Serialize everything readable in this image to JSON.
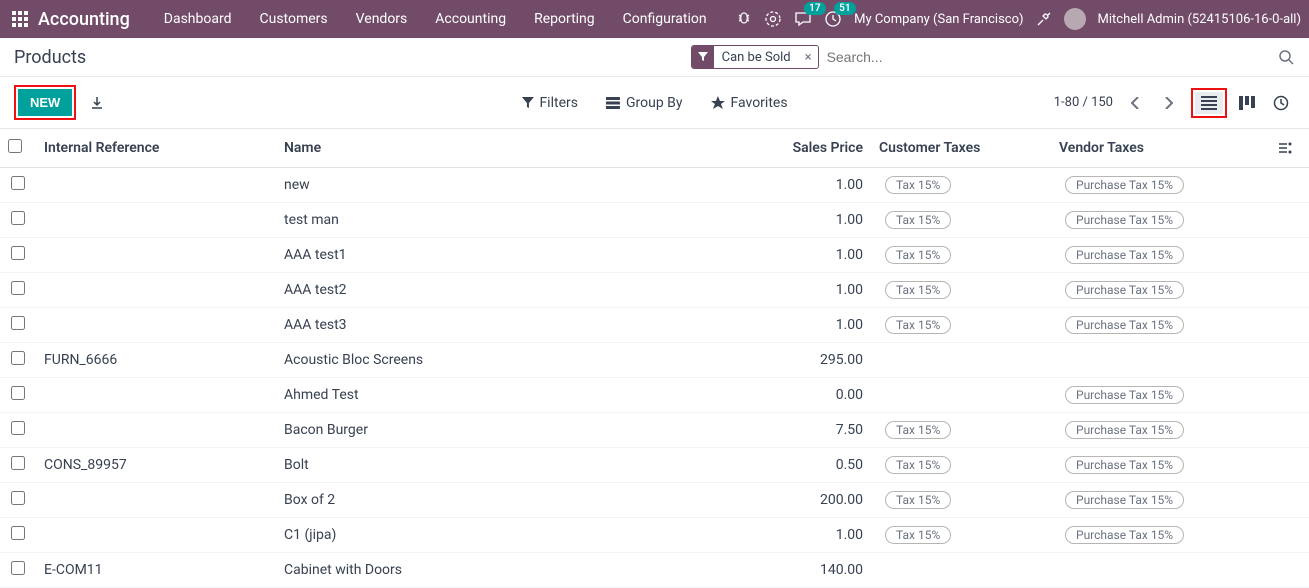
{
  "topnav": {
    "brand": "Accounting",
    "menu": [
      "Dashboard",
      "Customers",
      "Vendors",
      "Accounting",
      "Reporting",
      "Configuration"
    ],
    "chat_badge": "17",
    "activity_badge": "51",
    "company": "My Company (San Francisco)",
    "user": "Mitchell Admin (52415106-16-0-all)"
  },
  "page": {
    "title": "Products",
    "new_label": "NEW"
  },
  "search": {
    "facet_label": "Can be Sold",
    "placeholder": "Search..."
  },
  "controls": {
    "filters": "Filters",
    "group_by": "Group By",
    "favorites": "Favorites",
    "pager": "1-80 / 150"
  },
  "table": {
    "headers": {
      "ref": "Internal Reference",
      "name": "Name",
      "price": "Sales Price",
      "ctax": "Customer Taxes",
      "vtax": "Vendor Taxes"
    },
    "rows": [
      {
        "ref": "",
        "name": "new",
        "price": "1.00",
        "ctax": "Tax 15%",
        "vtax": "Purchase Tax 15%"
      },
      {
        "ref": "",
        "name": "test man",
        "price": "1.00",
        "ctax": "Tax 15%",
        "vtax": "Purchase Tax 15%"
      },
      {
        "ref": "",
        "name": "AAA test1",
        "price": "1.00",
        "ctax": "Tax 15%",
        "vtax": "Purchase Tax 15%"
      },
      {
        "ref": "",
        "name": "AAA test2",
        "price": "1.00",
        "ctax": "Tax 15%",
        "vtax": "Purchase Tax 15%"
      },
      {
        "ref": "",
        "name": "AAA test3",
        "price": "1.00",
        "ctax": "Tax 15%",
        "vtax": "Purchase Tax 15%"
      },
      {
        "ref": "FURN_6666",
        "name": "Acoustic Bloc Screens",
        "price": "295.00",
        "ctax": "",
        "vtax": ""
      },
      {
        "ref": "",
        "name": "Ahmed Test",
        "price": "0.00",
        "ctax": "",
        "vtax": "Purchase Tax 15%"
      },
      {
        "ref": "",
        "name": "Bacon Burger",
        "price": "7.50",
        "ctax": "Tax 15%",
        "vtax": "Purchase Tax 15%"
      },
      {
        "ref": "CONS_89957",
        "name": "Bolt",
        "price": "0.50",
        "ctax": "Tax 15%",
        "vtax": "Purchase Tax 15%"
      },
      {
        "ref": "",
        "name": "Box of 2",
        "price": "200.00",
        "ctax": "Tax 15%",
        "vtax": "Purchase Tax 15%"
      },
      {
        "ref": "",
        "name": "C1 (jipa)",
        "price": "1.00",
        "ctax": "Tax 15%",
        "vtax": "Purchase Tax 15%"
      },
      {
        "ref": "E-COM11",
        "name": "Cabinet with Doors",
        "price": "140.00",
        "ctax": "",
        "vtax": ""
      }
    ]
  }
}
